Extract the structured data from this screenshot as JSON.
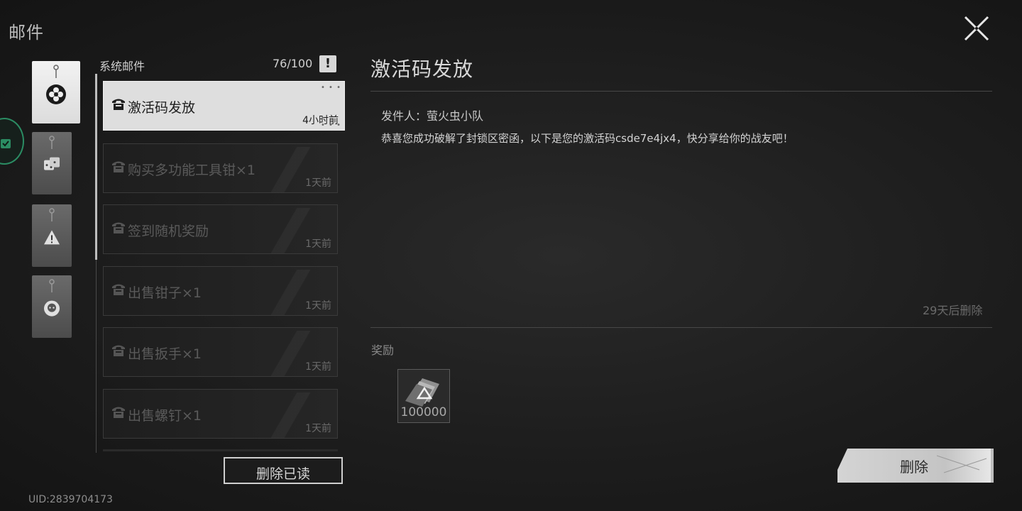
{
  "header": {
    "title": "邮件",
    "close_icon": "close-icon"
  },
  "footer": {
    "uid": "UID:2839704173"
  },
  "categories": [
    {
      "name": "system-mail",
      "icon": "flower-icon",
      "selected": true
    },
    {
      "name": "shop-mail",
      "icon": "dice-icon",
      "selected": false
    },
    {
      "name": "alert-mail",
      "icon": "warning-icon",
      "selected": false
    },
    {
      "name": "friend-mail",
      "icon": "person-icon",
      "selected": false
    }
  ],
  "list": {
    "header_label": "系统邮件",
    "count": "76/100",
    "alert_glyph": "!",
    "items": [
      {
        "subject": "激活码发放",
        "time": "4小时前",
        "active": true
      },
      {
        "subject": "购买多功能工具钳×1",
        "time": "1天前",
        "active": false
      },
      {
        "subject": "签到随机奖励",
        "time": "1天前",
        "active": false
      },
      {
        "subject": "出售钳子×1",
        "time": "1天前",
        "active": false
      },
      {
        "subject": "出售扳手×1",
        "time": "1天前",
        "active": false
      },
      {
        "subject": "出售螺钉×1",
        "time": "1天前",
        "active": false
      }
    ],
    "delete_read_label": "删除已读"
  },
  "detail": {
    "title": "激活码发放",
    "sender": "发件人：萤火虫小队",
    "body": "恭喜您成功破解了封锁区密函，以下是您的激活码csde7e4jx4，快分享给你的战友吧！",
    "expire": "29天后删除",
    "reward_label": "奖励",
    "rewards": [
      {
        "icon": "currency-icon",
        "quantity": "100000"
      }
    ],
    "delete_label": "删除"
  },
  "colors": {
    "accent_green": "#2b8c63",
    "active_item_bg": "#dedede"
  }
}
